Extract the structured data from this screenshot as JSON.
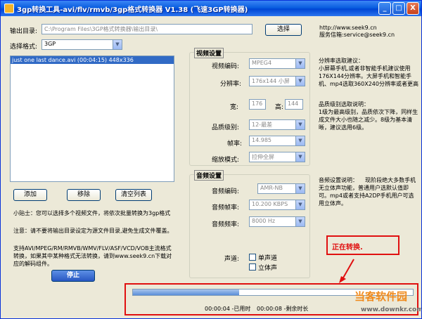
{
  "window": {
    "title": "3gp转换工具-avi/flv/rmvb/3gp格式转换器 V1.38 (飞速3GP转换器)",
    "buttons": [
      "_",
      "□",
      "X"
    ]
  },
  "output": {
    "label": "输出目录:",
    "path": "C:\\Program Files\\3GP格式转换器\\输出目录\\",
    "browse_label": "选择"
  },
  "contact": {
    "url": "http://www.seek9.cn",
    "email": "服务信箱:service@seek9.cn"
  },
  "format": {
    "label": "选择格式:",
    "value": "3GP"
  },
  "file_list": {
    "items": [
      "just one last dance.avi (00:04:15) 448x336"
    ]
  },
  "list_buttons": {
    "add": "添加",
    "remove": "移除",
    "clear": "清空列表"
  },
  "video_settings": {
    "title": "视频设置",
    "codec_label": "视频编码:",
    "codec_value": "MPEG4",
    "resolution_label": "分辨率:",
    "resolution_value": "176x144 小屏",
    "width_label": "宽:",
    "width_value": "176",
    "height_label": "高:",
    "height_value": "144",
    "quality_label": "品质级别:",
    "quality_value": "12-最差",
    "fps_label": "帧率:",
    "fps_value": "14.985",
    "zoom_label": "缩放模式:",
    "zoom_value": "拉伸全屏"
  },
  "audio_settings": {
    "title": "音频设置",
    "codec_label": "音频编码:",
    "codec_value": "AMR-NB",
    "rate_label": "音频帧率:",
    "rate_value": "10.200 KBPS",
    "freq_label": "音频频率:",
    "freq_value": "8000 Hz",
    "channel_label": "声道:",
    "mono_label": "单声道",
    "stereo_label": "立体声"
  },
  "notes": {
    "resolution_tip": "分辨率选取建议：\n小屏幕手机,或者非智能手机建议使用176X144分辨率。大屏手机和智能手机、mp4选取360X240分辨率或者更高",
    "quality_tip": "品质级别选取说明：\n1级为最高级别，品质依次下降，同样生成文件大小也随之减少。8级为基本清晰，建议选用6级。",
    "audio_tip": "音频设置说明：    现阶段绝大多数手机无立体声功能，普通用户选默认值即可。mp4或者支持A2DP手机用户可选用立体声。"
  },
  "tips": {
    "tip1": "小贴士：您可以选择多个视频文件，将依次批量转换为3gp格式",
    "tip2": "注意：请不要将输出目录设定为源文件目录,避免生成文件覆盖。",
    "tip3": "支持AVI/MPEG/RM/RMVB/WMV/FLV/ASF/VCD/VOB主流格式转换，如果其中某种格式无法转换，请到www.seek9.cn下载对应的解码组件。"
  },
  "stop_button": "停止",
  "status": {
    "converting": "正在转换.",
    "elapsed": "00:00:04 -已用时",
    "remaining": "00:00:08 -剩余时长",
    "progress": 0.38
  },
  "watermark": {
    "brand": "当客软件园",
    "url": "www.downkr.com"
  }
}
